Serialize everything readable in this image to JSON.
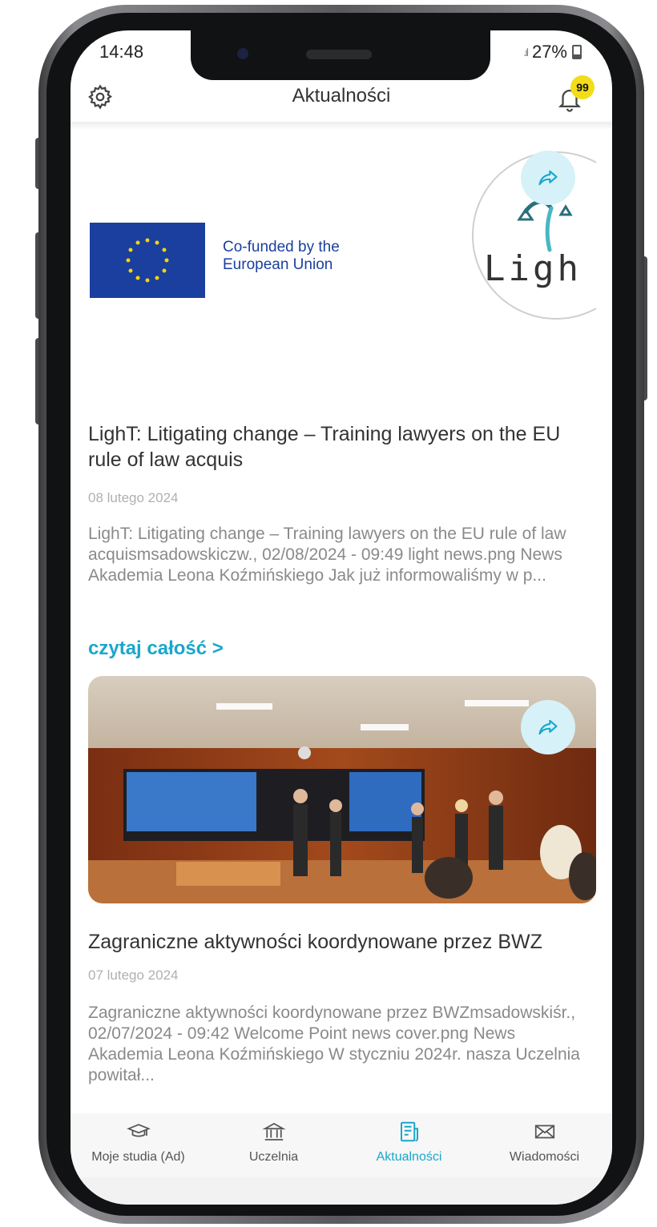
{
  "status_bar": {
    "time": "14:48",
    "battery": "27%"
  },
  "header": {
    "title": "Aktualności",
    "notifications_count": "99"
  },
  "articles": [
    {
      "image_caption": "Co-funded by the European Union",
      "image_caption_line1": "Co-funded by the",
      "image_caption_line2": "European Union",
      "logo_text": "Ligh",
      "title": "LighT: Litigating change – Training lawyers on the EU rule of law acquis",
      "date": "08 lutego 2024",
      "excerpt": "LighT: Litigating change – Training lawyers on the EU rule of law acquismsadowskiczw., 02/08/2024 - 09:49 light news.png News Akademia Leona Koźmińskiego Jak już informowaliśmy w p...",
      "read_more": "czytaj całość >"
    },
    {
      "title": "Zagraniczne aktywności koordynowane przez BWZ",
      "date": "07 lutego 2024",
      "excerpt": "Zagraniczne aktywności koordynowane przez BWZmsadowskiśr., 02/07/2024 - 09:42 Welcome Point news cover.png News Akademia Leona Koźmińskiego W styczniu 2024r. nasza Uczelnia powitał..."
    }
  ],
  "bottom_nav": [
    {
      "label": "Moje studia (Ad)",
      "icon": "graduation-cap-icon"
    },
    {
      "label": "Uczelnia",
      "icon": "university-icon"
    },
    {
      "label": "Aktualności",
      "icon": "news-icon",
      "active": true
    },
    {
      "label": "Wiadomości",
      "icon": "envelope-icon"
    }
  ],
  "colors": {
    "accent": "#1aa6cc",
    "badge": "#f3dd1a",
    "eu_blue": "#1a3f9e"
  }
}
